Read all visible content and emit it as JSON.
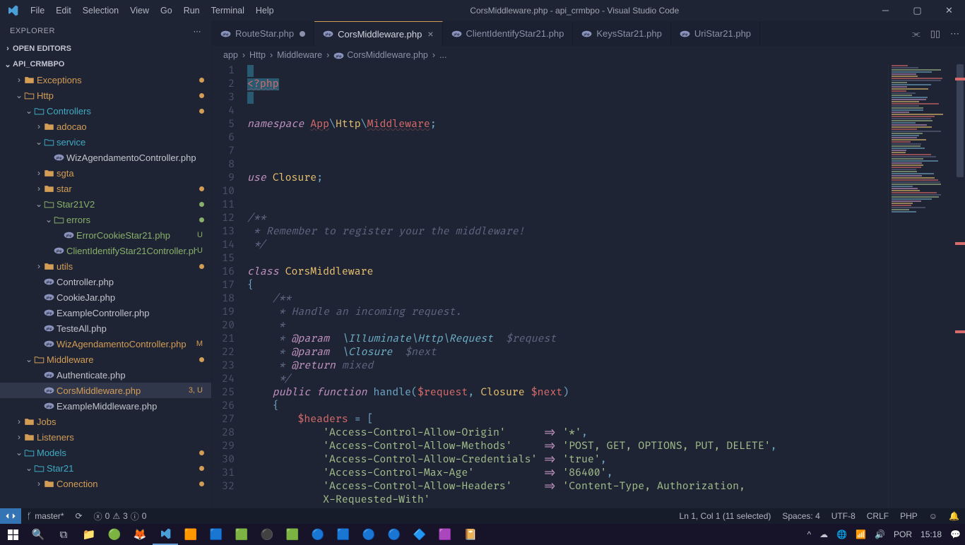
{
  "titlebar": {
    "menus": [
      "File",
      "Edit",
      "Selection",
      "View",
      "Go",
      "Run",
      "Terminal",
      "Help"
    ],
    "title": "CorsMiddleware.php - api_crmbpo - Visual Studio Code"
  },
  "sidebar": {
    "header": "EXPLORER",
    "sections": {
      "openEditors": "OPEN EDITORS",
      "project": "API_CRMBPO"
    },
    "tree": [
      {
        "d": 1,
        "t": "folder",
        "open": false,
        "label": "Exceptions",
        "git": "m",
        "cls": "folder-orange"
      },
      {
        "d": 1,
        "t": "folder",
        "open": true,
        "label": "Http",
        "git": "m",
        "cls": "folder-open git-mod"
      },
      {
        "d": 2,
        "t": "folder",
        "open": true,
        "label": "Controllers",
        "git": "m",
        "cls": "folder-open"
      },
      {
        "d": 3,
        "t": "folder",
        "open": false,
        "label": "adocao",
        "cls": "folder-orange"
      },
      {
        "d": 3,
        "t": "folder",
        "open": true,
        "label": "service",
        "cls": "folder-open"
      },
      {
        "d": 4,
        "t": "file",
        "icon": "php",
        "label": "WizAgendamentoController.php"
      },
      {
        "d": 3,
        "t": "folder",
        "open": false,
        "label": "sgta",
        "cls": "folder-orange"
      },
      {
        "d": 3,
        "t": "folder",
        "open": false,
        "label": "star",
        "git": "m",
        "cls": "folder-orange"
      },
      {
        "d": 3,
        "t": "folder",
        "open": true,
        "label": "Star21V2",
        "git": "u",
        "cls": "folder-open git-untracked"
      },
      {
        "d": 4,
        "t": "folder",
        "open": true,
        "label": "errors",
        "git": "u",
        "cls": "folder-open git-untracked"
      },
      {
        "d": 5,
        "t": "file",
        "icon": "php",
        "label": "ErrorCookieStar21.php",
        "git": "u",
        "badge": "U",
        "cls": "git-untracked"
      },
      {
        "d": 4,
        "t": "file",
        "icon": "php",
        "label": "ClientIdentifyStar21Controller.php",
        "git": "u",
        "badge": "U",
        "cls": "git-untracked"
      },
      {
        "d": 3,
        "t": "folder",
        "open": false,
        "label": "utils",
        "git": "m",
        "cls": "folder-orange"
      },
      {
        "d": 3,
        "t": "file",
        "icon": "php",
        "label": "Controller.php"
      },
      {
        "d": 3,
        "t": "file",
        "icon": "php",
        "label": "CookieJar.php"
      },
      {
        "d": 3,
        "t": "file",
        "icon": "php",
        "label": "ExampleController.php"
      },
      {
        "d": 3,
        "t": "file",
        "icon": "php",
        "label": "TesteAll.php"
      },
      {
        "d": 3,
        "t": "file",
        "icon": "php",
        "label": "WizAgendamentoController.php",
        "git": "m",
        "badge": "M",
        "cls": "git-mod"
      },
      {
        "d": 2,
        "t": "folder",
        "open": true,
        "label": "Middleware",
        "git": "m",
        "cls": "folder-open git-mod"
      },
      {
        "d": 3,
        "t": "file",
        "icon": "php",
        "label": "Authenticate.php"
      },
      {
        "d": 3,
        "t": "file",
        "icon": "php",
        "label": "CorsMiddleware.php",
        "git": "m",
        "badge": "3, U",
        "cls": "git-mod",
        "active": true
      },
      {
        "d": 3,
        "t": "file",
        "icon": "php",
        "label": "ExampleMiddleware.php"
      },
      {
        "d": 1,
        "t": "folder",
        "open": false,
        "label": "Jobs",
        "cls": "folder-orange"
      },
      {
        "d": 1,
        "t": "folder",
        "open": false,
        "label": "Listeners",
        "cls": "folder-orange"
      },
      {
        "d": 1,
        "t": "folder",
        "open": true,
        "label": "Models",
        "git": "m",
        "cls": "folder-open"
      },
      {
        "d": 2,
        "t": "folder",
        "open": true,
        "label": "Star21",
        "git": "m",
        "cls": "folder-open"
      },
      {
        "d": 3,
        "t": "folder",
        "open": false,
        "label": "Conection",
        "git": "m",
        "cls": "folder-orange"
      }
    ]
  },
  "tabs": [
    {
      "label": "RouteStar.php",
      "dirty": true
    },
    {
      "label": "CorsMiddleware.php",
      "active": true
    },
    {
      "label": "ClientIdentifyStar21.php"
    },
    {
      "label": "KeysStar21.php"
    },
    {
      "label": "UriStar21.php"
    }
  ],
  "breadcrumb": [
    "app",
    "Http",
    "Middleware",
    "CorsMiddleware.php",
    "..."
  ],
  "code": {
    "lines": [
      {
        "n": 1,
        "h": "<span class='sel'> </span>"
      },
      {
        "n": 2,
        "h": "<span class='sel'><span class='s-ns'>&lt;?php</span></span>"
      },
      {
        "n": 3,
        "h": "<span class='sel'> </span>"
      },
      {
        "n": 4,
        "h": ""
      },
      {
        "n": 5,
        "h": "<span class='s-kw'>namespace</span> <span class='s-ns'>App</span><span class='s-punct'>\\</span><span class='s-class'>Http</span><span class='s-punct'>\\</span><span class='s-ns'>Middleware</span><span class='s-punct'>;</span>"
      },
      {
        "n": 6,
        "h": ""
      },
      {
        "n": 7,
        "h": ""
      },
      {
        "n": 8,
        "h": ""
      },
      {
        "n": 9,
        "h": "<span class='s-kw'>use</span> <span class='s-class'>Closure</span><span class='s-punct'>;</span>"
      },
      {
        "n": 10,
        "h": ""
      },
      {
        "n": 11,
        "h": ""
      },
      {
        "n": 12,
        "h": "<span class='s-comment'>/**</span>"
      },
      {
        "n": 13,
        "h": "<span class='s-comment'> * Remember to register your the middleware!</span>"
      },
      {
        "n": 14,
        "h": "<span class='s-comment'> */</span>"
      },
      {
        "n": 15,
        "h": ""
      },
      {
        "n": 16,
        "h": "<span class='s-kw'>class</span> <span class='s-class'>CorsMiddleware</span>"
      },
      {
        "n": 17,
        "h": "<span class='s-punct'>{</span>"
      },
      {
        "n": 18,
        "h": "    <span class='s-comment'>/**</span>"
      },
      {
        "n": 19,
        "h": "<span class='s-comment'>     * Handle an incoming request.</span>"
      },
      {
        "n": 20,
        "h": "<span class='s-comment'>     *</span>"
      },
      {
        "n": 21,
        "h": "<span class='s-comment'>     * <span class='s-doctag'>@param</span>  <span class='s-punct'>\\</span><span class='s-type'>Illuminate</span><span class='s-punct'>\\</span><span class='s-type'>Http</span><span class='s-punct'>\\</span><span class='s-type'>Request</span>  $request</span>"
      },
      {
        "n": 22,
        "h": "<span class='s-comment'>     * <span class='s-doctag'>@param</span>  <span class='s-punct'>\\</span><span class='s-type'>Closure</span>  $next</span>"
      },
      {
        "n": 23,
        "h": "<span class='s-comment'>     * <span class='s-doctag'>@return</span> mixed</span>"
      },
      {
        "n": 24,
        "h": "<span class='s-comment'>     */</span>"
      },
      {
        "n": 25,
        "h": "    <span class='s-kw'>public</span> <span class='s-kw'>function</span> <span class='s-func'>handle</span><span class='s-punct'>(</span><span class='s-var'>$request</span><span class='s-punct'>,</span> <span class='s-class'>Closure</span> <span class='s-var'>$next</span><span class='s-punct'>)</span>"
      },
      {
        "n": 26,
        "h": "    <span class='s-punct'>{</span>"
      },
      {
        "n": 27,
        "h": "        <span class='s-var'>$headers</span> <span class='s-punct'>=</span> <span class='s-punct'>[</span>"
      },
      {
        "n": 28,
        "h": "            <span class='s-str'>'Access-Control-Allow-Origin'</span>      <span class='s-arrow'>=&gt;</span> <span class='s-str'>'*'</span><span class='s-punct'>,</span>"
      },
      {
        "n": 29,
        "h": "            <span class='s-str'>'Access-Control-Allow-Methods'</span>     <span class='s-arrow'>=&gt;</span> <span class='s-str'>'POST, GET, OPTIONS, PUT, DELETE'</span><span class='s-punct'>,</span>"
      },
      {
        "n": 30,
        "h": "            <span class='s-str'>'Access-Control-Allow-Credentials'</span> <span class='s-arrow'>=&gt;</span> <span class='s-str'>'true'</span><span class='s-punct'>,</span>"
      },
      {
        "n": 31,
        "h": "            <span class='s-str'>'Access-Control-Max-Age'</span>           <span class='s-arrow'>=&gt;</span> <span class='s-str'>'86400'</span><span class='s-punct'>,</span>"
      },
      {
        "n": 32,
        "h": "            <span class='s-str'>'Access-Control-Allow-Headers'</span>     <span class='s-arrow'>=&gt;</span> <span class='s-str'>'Content-Type, Authorization,</span>"
      },
      {
        "n": "",
        "h": "<span class='s-str'>            X-Requested-With'</span>"
      }
    ]
  },
  "statusbar": {
    "branch": "master*",
    "errors": "0",
    "warnings": "3",
    "info": "0",
    "position": "Ln 1, Col 1 (11 selected)",
    "spaces": "Spaces: 4",
    "encoding": "UTF-8",
    "eol": "CRLF",
    "lang": "PHP"
  },
  "taskbar": {
    "lang": "POR",
    "time": "15:18"
  }
}
